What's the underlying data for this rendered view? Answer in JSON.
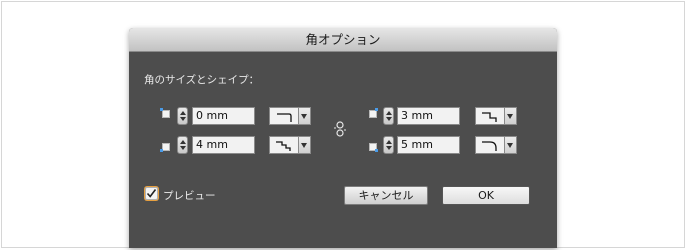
{
  "dialog": {
    "title": "角オプション",
    "section_label": "角のサイズとシェイプ：",
    "corners": [
      {
        "id": "top-left",
        "value": "0 mm",
        "shape": "inverse-rounded"
      },
      {
        "id": "top-right",
        "value": "3 mm",
        "shape": "inset"
      },
      {
        "id": "bottom-left",
        "value": "4 mm",
        "shape": "fancy"
      },
      {
        "id": "bottom-right",
        "value": "5 mm",
        "shape": "rounded"
      }
    ],
    "link_icon": "chain-link-icon",
    "preview_label": "プレビュー",
    "preview_checked": true,
    "cancel_label": "キャンセル",
    "ok_label": "OK"
  },
  "colors": {
    "dialog_bg": "#4d4d4d",
    "corner_dot": "#4a9be8",
    "checkbox_focus": "#e7a040"
  }
}
